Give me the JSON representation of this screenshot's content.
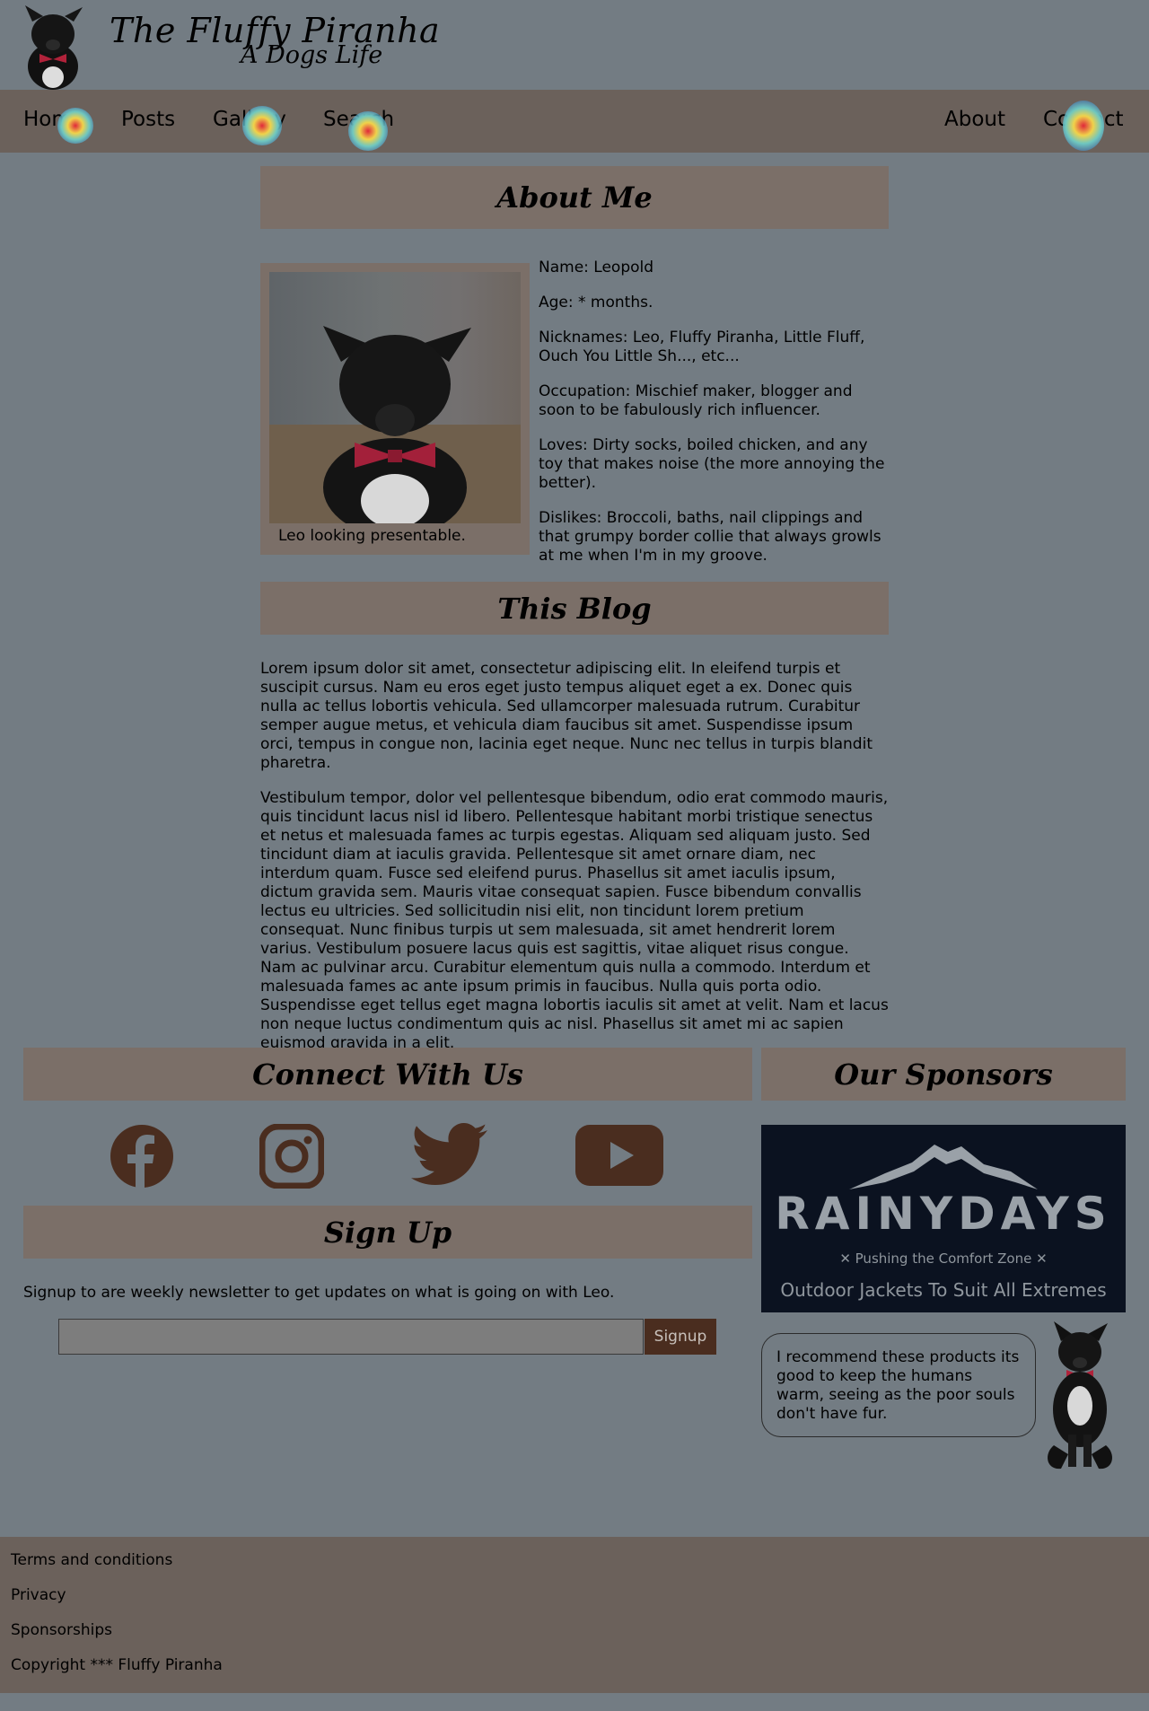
{
  "header": {
    "title": "The Fluffy Piranha",
    "subtitle": "A Dogs Life"
  },
  "nav": {
    "left": [
      "Home",
      "Posts",
      "Gallery",
      "Search"
    ],
    "right": [
      "About",
      "Contact"
    ]
  },
  "about": {
    "heading": "About Me",
    "photo_caption": "Leo looking presentable.",
    "facts": [
      "Name: Leopold",
      "Age: * months.",
      "Nicknames: Leo, Fluffy Piranha, Little Fluff, Ouch You Little Sh..., etc...",
      "Occupation: Mischief maker, blogger and soon to be fabulously rich influencer.",
      "Loves: Dirty socks, boiled chicken, and any toy that makes noise (the more annoying the better).",
      "Dislikes: Broccoli, baths, nail clippings and that grumpy border collie that always growls at me when I'm in my groove."
    ]
  },
  "blog": {
    "heading": "This Blog",
    "paragraphs": [
      "Lorem ipsum dolor sit amet, consectetur adipiscing elit. In eleifend turpis et suscipit cursus. Nam eu eros eget justo tempus aliquet eget a ex. Donec quis nulla ac tellus lobortis vehicula. Sed ullamcorper malesuada rutrum. Curabitur semper augue metus, et vehicula diam faucibus sit amet. Suspendisse ipsum orci, tempus in congue non, lacinia eget neque. Nunc nec tellus in turpis blandit pharetra.",
      "Vestibulum tempor, dolor vel pellentesque bibendum, odio erat commodo mauris, quis tincidunt lacus nisl id libero. Pellentesque habitant morbi tristique senectus et netus et malesuada fames ac turpis egestas. Aliquam sed aliquam justo. Sed tincidunt diam at iaculis gravida. Pellentesque sit amet ornare diam, nec interdum quam. Fusce sed eleifend purus. Phasellus sit amet iaculis ipsum, dictum gravida sem. Mauris vitae consequat sapien. Fusce bibendum convallis lectus eu ultricies. Sed sollicitudin nisi elit, non tincidunt lorem pretium consequat. Nunc finibus turpis ut sem malesuada, sit amet hendrerit lorem varius. Vestibulum posuere lacus quis est sagittis, vitae aliquet risus congue. Nam ac pulvinar arcu. Curabitur elementum quis nulla a commodo. Interdum et malesuada fames ac ante ipsum primis in faucibus. Nulla quis porta odio. Suspendisse eget tellus eget magna lobortis iaculis sit amet at velit. Nam et lacus non neque luctus condimentum quis ac nisl. Phasellus sit amet mi ac sapien euismod gravida in a elit."
    ]
  },
  "connect": {
    "heading": "Connect With Us",
    "icons": [
      "facebook-icon",
      "instagram-icon",
      "twitter-icon",
      "youtube-icon"
    ]
  },
  "signup": {
    "heading": "Sign Up",
    "text": "Signup to are weekly newsletter to get updates on what is going on with Leo.",
    "input_value": "",
    "button_label": "Signup"
  },
  "sponsors": {
    "heading": "Our Sponsors",
    "brand": "RAINYDAYS",
    "tagline": "✕ Pushing the Comfort Zone ✕",
    "cta": "Outdoor Jackets To Suit All Extremes",
    "recommendation": "I recommend these products its good to keep the humans warm, seeing as the poor souls don't have fur."
  },
  "footer": {
    "links": [
      "Terms and conditions",
      "Privacy",
      "Sponsorships",
      "Copyright *** Fluffy Piranha"
    ]
  },
  "colors": {
    "page_bg": "#737c83",
    "bar_bg": "#6b615b",
    "section_bg": "#7b6f68",
    "accent_brown": "#4a2d1f",
    "sponsor_bg": "#0b1220"
  }
}
